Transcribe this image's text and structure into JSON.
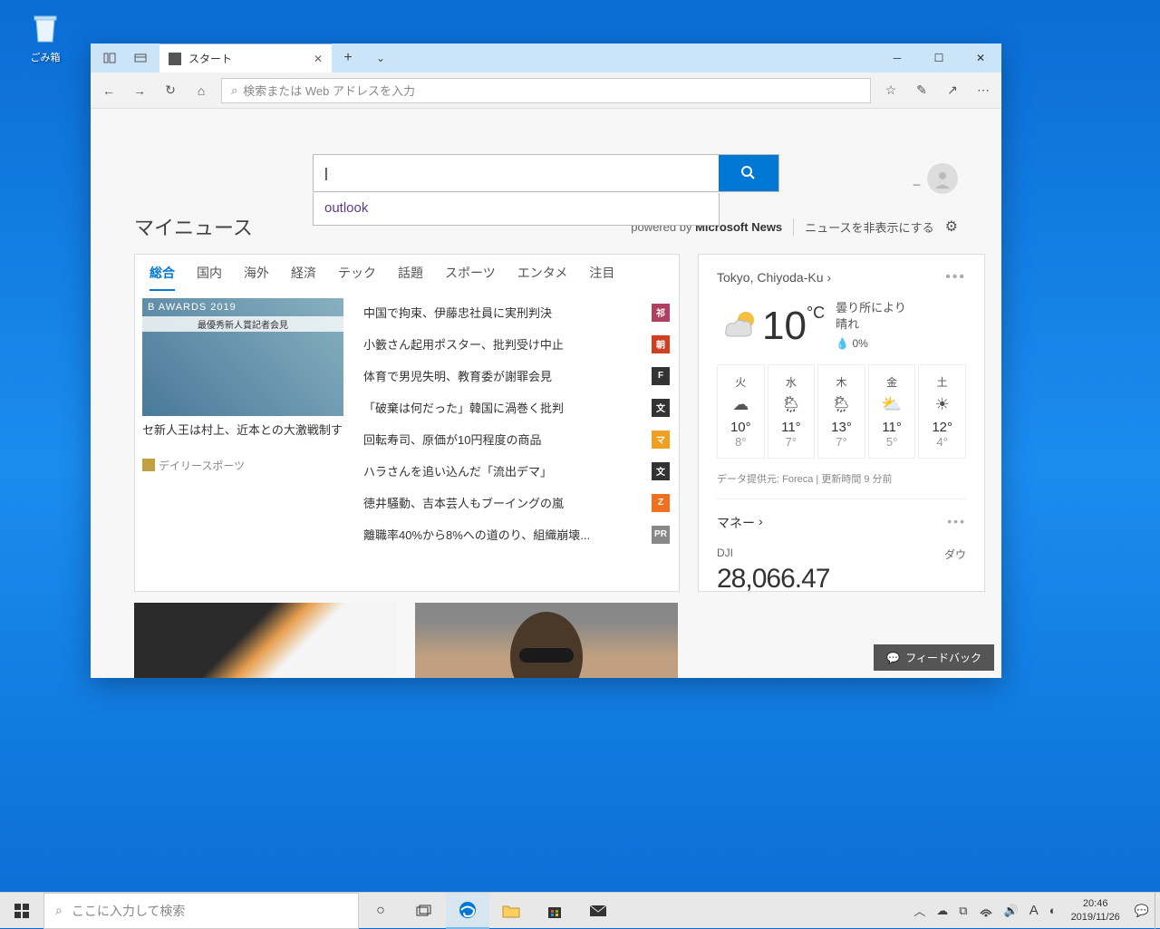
{
  "desktop": {
    "recycle_bin": "ごみ箱"
  },
  "tab": {
    "title": "スタート"
  },
  "addressbar": {
    "placeholder": "検索または Web アドレスを入力"
  },
  "search": {
    "suggestion": "outlook"
  },
  "mynews": {
    "title": "マイニュース",
    "powered_prefix": "powered by ",
    "powered_brand": "Microsoft News",
    "hide": "ニュースを非表示にする"
  },
  "news_tabs": [
    "総合",
    "国内",
    "海外",
    "経済",
    "テック",
    "話題",
    "スポーツ",
    "エンタメ",
    "注目"
  ],
  "featured": {
    "img_banner": "B AWARDS 2019",
    "img_sub": "最優秀新人賞記者会見",
    "title": "セ新人王は村上、近本との大激戦制す",
    "source": "デイリースポーツ"
  },
  "headlines": [
    {
      "text": "中国で拘束、伊藤忠社員に実刑判決",
      "badge": "祁",
      "color": "#b04060"
    },
    {
      "text": "小籔さん起用ポスター、批判受け中止",
      "badge": "朝",
      "color": "#d04020"
    },
    {
      "text": "体育で男児失明、教育委が謝罪会見",
      "badge": "F",
      "color": "#333"
    },
    {
      "text": "「破棄は何だった」韓国に渦巻く批判",
      "badge": "文",
      "color": "#333"
    },
    {
      "text": "回転寿司、原価が10円程度の商品",
      "badge": "マ",
      "color": "#f0a020"
    },
    {
      "text": "ハラさんを追い込んだ「流出デマ」",
      "badge": "文",
      "color": "#333"
    },
    {
      "text": "徳井騒動、吉本芸人もブーイングの嵐",
      "badge": "Z",
      "color": "#f07020"
    },
    {
      "text": "離職率40%から8%への道のり、組織崩壊...",
      "badge": "PR",
      "color": "#888"
    }
  ],
  "weather": {
    "location": "Tokyo, Chiyoda-Ku",
    "temp": "10",
    "unit": "°C",
    "desc": "曇り所により晴れ",
    "rain": "0%",
    "forecast": [
      {
        "day": "火",
        "hi": "10°",
        "lo": "8°"
      },
      {
        "day": "水",
        "hi": "11°",
        "lo": "7°"
      },
      {
        "day": "木",
        "hi": "13°",
        "lo": "7°"
      },
      {
        "day": "金",
        "hi": "11°",
        "lo": "5°"
      },
      {
        "day": "土",
        "hi": "12°",
        "lo": "4°"
      }
    ],
    "attribution": "データ提供元: Foreca | 更新時間 9 分前"
  },
  "money": {
    "title": "マネー",
    "index_symbol": "DJI",
    "index_name": "ダウ",
    "value_partial": "28,066.47"
  },
  "feedback": "フィードバック",
  "taskbar": {
    "search_placeholder": "ここに入力して検索",
    "time": "20:46",
    "date": "2019/11/26",
    "ime": "A"
  }
}
